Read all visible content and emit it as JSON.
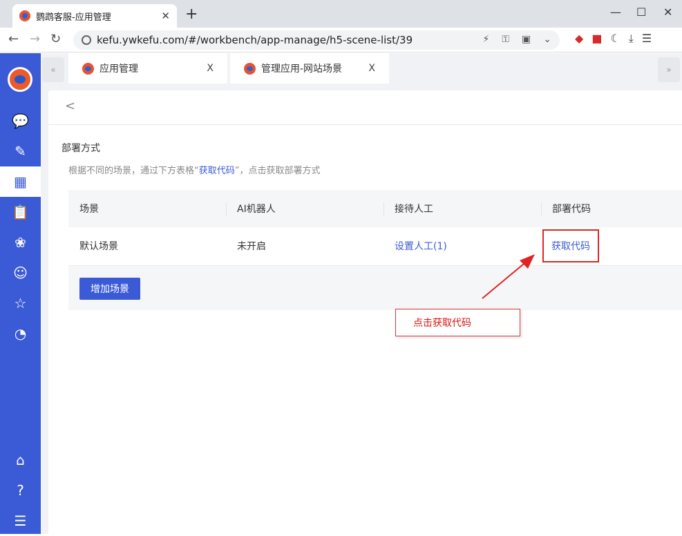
{
  "browser": {
    "tab_title": "鹦鹉客服-应用管理",
    "tab_close": "✕",
    "new_tab": "+",
    "url": "kefu.ywkefu.com/#/workbench/app-manage/h5-scene-list/39"
  },
  "app_tabs": [
    {
      "label": "应用管理",
      "close": "X"
    },
    {
      "label": "管理应用-网站场景",
      "close": "X"
    }
  ],
  "page": {
    "back": "<",
    "section_title": "部署方式",
    "desc_pre": "根据不同的场景，通过下方表格“",
    "desc_highlight": "获取代码",
    "desc_post": "”，点击获取部署方式"
  },
  "table": {
    "headers": [
      "场景",
      "AI机器人",
      "接待人工",
      "部署代码"
    ],
    "rows": [
      {
        "scene": "默认场景",
        "ai": "未开启",
        "staff": "设置人工(1)",
        "code": "获取代码"
      }
    ]
  },
  "add_button": "增加场景",
  "annotation": "点击获取代码",
  "colors": {
    "primary": "#3b5bd6",
    "highlight_border": "#e02424"
  }
}
